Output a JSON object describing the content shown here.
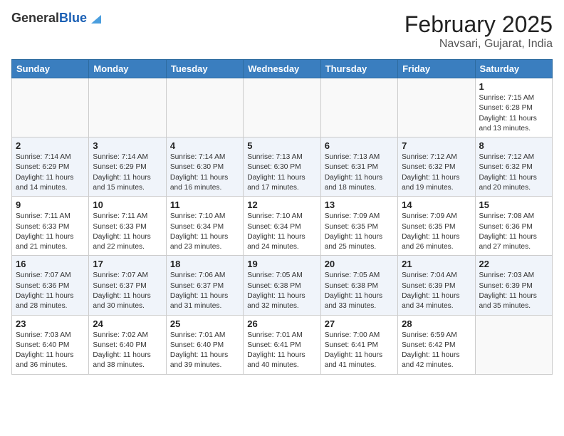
{
  "header": {
    "logo_general": "General",
    "logo_blue": "Blue",
    "month_title": "February 2025",
    "location": "Navsari, Gujarat, India"
  },
  "weekdays": [
    "Sunday",
    "Monday",
    "Tuesday",
    "Wednesday",
    "Thursday",
    "Friday",
    "Saturday"
  ],
  "weeks": [
    [
      {
        "day": "",
        "info": ""
      },
      {
        "day": "",
        "info": ""
      },
      {
        "day": "",
        "info": ""
      },
      {
        "day": "",
        "info": ""
      },
      {
        "day": "",
        "info": ""
      },
      {
        "day": "",
        "info": ""
      },
      {
        "day": "1",
        "info": "Sunrise: 7:15 AM\nSunset: 6:28 PM\nDaylight: 11 hours\nand 13 minutes."
      }
    ],
    [
      {
        "day": "2",
        "info": "Sunrise: 7:14 AM\nSunset: 6:29 PM\nDaylight: 11 hours\nand 14 minutes."
      },
      {
        "day": "3",
        "info": "Sunrise: 7:14 AM\nSunset: 6:29 PM\nDaylight: 11 hours\nand 15 minutes."
      },
      {
        "day": "4",
        "info": "Sunrise: 7:14 AM\nSunset: 6:30 PM\nDaylight: 11 hours\nand 16 minutes."
      },
      {
        "day": "5",
        "info": "Sunrise: 7:13 AM\nSunset: 6:30 PM\nDaylight: 11 hours\nand 17 minutes."
      },
      {
        "day": "6",
        "info": "Sunrise: 7:13 AM\nSunset: 6:31 PM\nDaylight: 11 hours\nand 18 minutes."
      },
      {
        "day": "7",
        "info": "Sunrise: 7:12 AM\nSunset: 6:32 PM\nDaylight: 11 hours\nand 19 minutes."
      },
      {
        "day": "8",
        "info": "Sunrise: 7:12 AM\nSunset: 6:32 PM\nDaylight: 11 hours\nand 20 minutes."
      }
    ],
    [
      {
        "day": "9",
        "info": "Sunrise: 7:11 AM\nSunset: 6:33 PM\nDaylight: 11 hours\nand 21 minutes."
      },
      {
        "day": "10",
        "info": "Sunrise: 7:11 AM\nSunset: 6:33 PM\nDaylight: 11 hours\nand 22 minutes."
      },
      {
        "day": "11",
        "info": "Sunrise: 7:10 AM\nSunset: 6:34 PM\nDaylight: 11 hours\nand 23 minutes."
      },
      {
        "day": "12",
        "info": "Sunrise: 7:10 AM\nSunset: 6:34 PM\nDaylight: 11 hours\nand 24 minutes."
      },
      {
        "day": "13",
        "info": "Sunrise: 7:09 AM\nSunset: 6:35 PM\nDaylight: 11 hours\nand 25 minutes."
      },
      {
        "day": "14",
        "info": "Sunrise: 7:09 AM\nSunset: 6:35 PM\nDaylight: 11 hours\nand 26 minutes."
      },
      {
        "day": "15",
        "info": "Sunrise: 7:08 AM\nSunset: 6:36 PM\nDaylight: 11 hours\nand 27 minutes."
      }
    ],
    [
      {
        "day": "16",
        "info": "Sunrise: 7:07 AM\nSunset: 6:36 PM\nDaylight: 11 hours\nand 28 minutes."
      },
      {
        "day": "17",
        "info": "Sunrise: 7:07 AM\nSunset: 6:37 PM\nDaylight: 11 hours\nand 30 minutes."
      },
      {
        "day": "18",
        "info": "Sunrise: 7:06 AM\nSunset: 6:37 PM\nDaylight: 11 hours\nand 31 minutes."
      },
      {
        "day": "19",
        "info": "Sunrise: 7:05 AM\nSunset: 6:38 PM\nDaylight: 11 hours\nand 32 minutes."
      },
      {
        "day": "20",
        "info": "Sunrise: 7:05 AM\nSunset: 6:38 PM\nDaylight: 11 hours\nand 33 minutes."
      },
      {
        "day": "21",
        "info": "Sunrise: 7:04 AM\nSunset: 6:39 PM\nDaylight: 11 hours\nand 34 minutes."
      },
      {
        "day": "22",
        "info": "Sunrise: 7:03 AM\nSunset: 6:39 PM\nDaylight: 11 hours\nand 35 minutes."
      }
    ],
    [
      {
        "day": "23",
        "info": "Sunrise: 7:03 AM\nSunset: 6:40 PM\nDaylight: 11 hours\nand 36 minutes."
      },
      {
        "day": "24",
        "info": "Sunrise: 7:02 AM\nSunset: 6:40 PM\nDaylight: 11 hours\nand 38 minutes."
      },
      {
        "day": "25",
        "info": "Sunrise: 7:01 AM\nSunset: 6:40 PM\nDaylight: 11 hours\nand 39 minutes."
      },
      {
        "day": "26",
        "info": "Sunrise: 7:01 AM\nSunset: 6:41 PM\nDaylight: 11 hours\nand 40 minutes."
      },
      {
        "day": "27",
        "info": "Sunrise: 7:00 AM\nSunset: 6:41 PM\nDaylight: 11 hours\nand 41 minutes."
      },
      {
        "day": "28",
        "info": "Sunrise: 6:59 AM\nSunset: 6:42 PM\nDaylight: 11 hours\nand 42 minutes."
      },
      {
        "day": "",
        "info": ""
      }
    ]
  ]
}
